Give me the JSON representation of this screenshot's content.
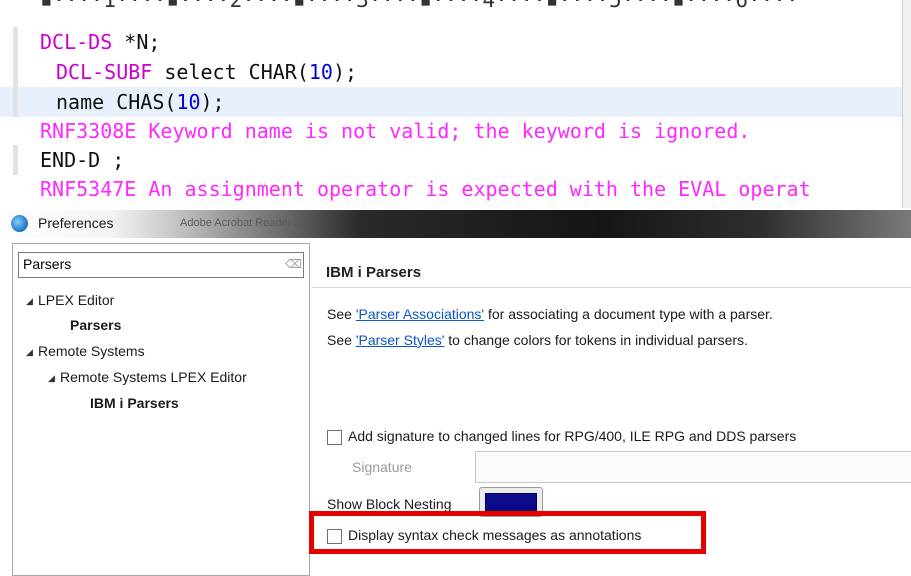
{
  "editor": {
    "ruler": "▪····1····▪····2····▪····3····▪····4····▪····5····▪····6····",
    "lines": [
      {
        "kw": "DCL-DS",
        "rest": " *N;"
      },
      {
        "kw": "DCL-SUBF",
        "rest": " select CHAR(",
        "num": "10",
        "tail": ");"
      },
      {
        "plain": "name CHAS(",
        "num": "10",
        "tail": ");"
      },
      {
        "msg": "RNF3308E Keyword name is not valid; the keyword is ignored."
      },
      {
        "plain": "END-D ;"
      },
      {
        "msg": "RNF5347E An assignment operator is expected with the EVAL operat"
      }
    ]
  },
  "dialog": {
    "title": "Preferences",
    "background_window_text": "Adobe Acrobat Reader DC",
    "filter_value": "Parsers",
    "tree": [
      {
        "label": "LPEX Editor",
        "twisty": "◢"
      },
      {
        "label": "Parsers"
      },
      {
        "label": "Remote Systems",
        "twisty": "◢"
      },
      {
        "label": "Remote Systems LPEX Editor",
        "twisty": "◢"
      },
      {
        "label": "IBM i Parsers"
      }
    ],
    "page_title": "IBM i Parsers",
    "line1": {
      "pre": "See ",
      "link": "'Parser Associations'",
      "post": " for associating a document type with a parser."
    },
    "line2": {
      "pre": "See ",
      "link": "'Parser Styles'",
      "post": " to change colors for tokens in individual parsers."
    },
    "add_signature_label": "Add signature to changed lines for RPG/400, ILE RPG and DDS parsers",
    "add_signature_checked": false,
    "signature_label": "Signature",
    "signature_value": "",
    "show_block_nesting_label": "Show Block Nesting",
    "block_nesting_color": "#0a0a8a",
    "display_syntax_label": "Display syntax check messages as annotations",
    "display_syntax_checked": false
  }
}
